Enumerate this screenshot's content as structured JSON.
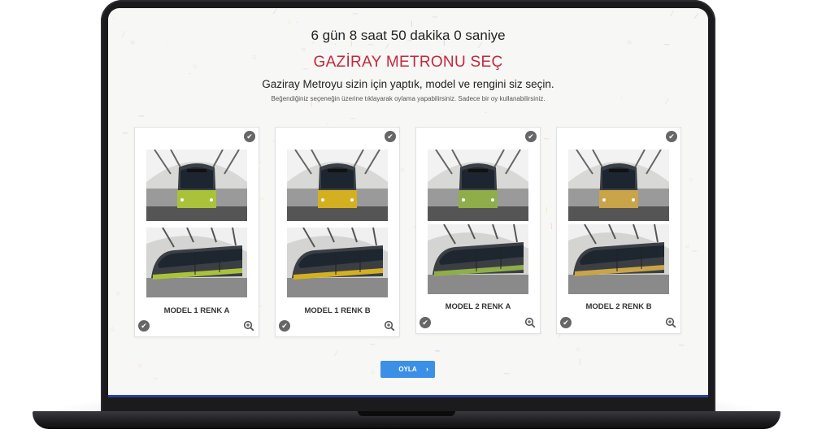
{
  "countdown": "6 gün 8 saat 50 dakika 0 saniye",
  "title": "GAZİRAY METRONU SEÇ",
  "subtitle": "Gaziray Metroyu sizin için yaptık, model ve rengini siz seçin.",
  "hint": "Beğendiğiniz seçeneğin üzerine tıklayarak oylama yapabilirsiniz. Sadece bir oy kullanabilirsiniz.",
  "cards": [
    {
      "label": "MODEL 1 RENK A",
      "accent": "#a9c23a"
    },
    {
      "label": "MODEL 1 RENK B",
      "accent": "#d4b021"
    },
    {
      "label": "MODEL 2 RENK A",
      "accent": "#8fae4a"
    },
    {
      "label": "MODEL 2 RENK B",
      "accent": "#c9a448"
    }
  ],
  "vote_button": "OYLA",
  "colors": {
    "title_red": "#c4283a",
    "button_blue": "#3c8fe6",
    "check_gray": "#666666"
  },
  "icons": [
    "check-circle-icon",
    "zoom-in-icon",
    "chevron-right-icon"
  ]
}
